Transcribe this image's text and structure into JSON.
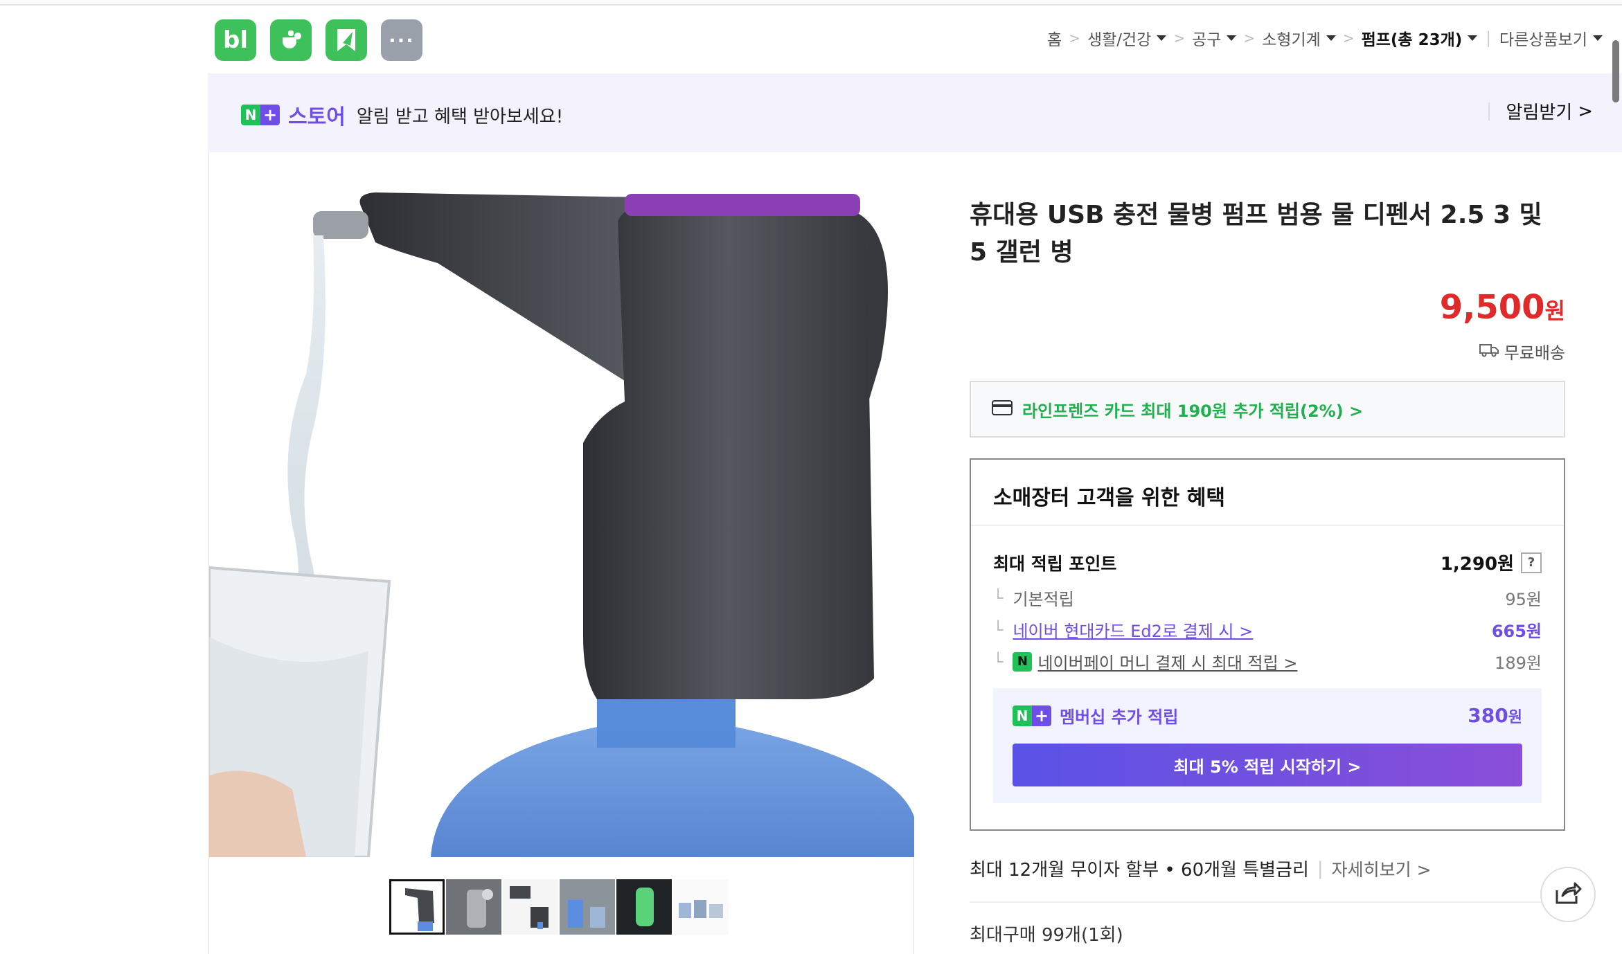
{
  "header": {
    "apps": [
      {
        "name": "blog",
        "label": "bl"
      },
      {
        "name": "cafe",
        "label": ""
      },
      {
        "name": "bookmark",
        "label": ""
      },
      {
        "name": "more",
        "label": "···"
      }
    ],
    "breadcrumb": {
      "home": "홈",
      "c1": "생활/건강",
      "c2": "공구",
      "c3": "소형기계",
      "c4": "펌프(총 23개)",
      "other": "다른상품보기"
    }
  },
  "banner": {
    "badge_n": "N",
    "badge_plus": "+",
    "store": "스토어",
    "message": "알림 받고 혜택 받아보세요!",
    "action": "알림받기",
    "action_chevron": ">"
  },
  "product": {
    "title": "휴대용 USB 충전 물병 펌프 범용 물 디펜서 2.5 3 및 5 갤런 병",
    "price": "9,500",
    "price_unit": "원",
    "shipping": "무료배송",
    "card_promo": "라인프렌즈 카드 최대 190원 추가 적립(2%) >"
  },
  "benefits": {
    "heading": "소매장터 고객을 위한 혜택",
    "max_points_label": "최대 적립 포인트",
    "max_points_value": "1,290원",
    "help": "?",
    "rows": [
      {
        "label": "기본적립",
        "value": "95원"
      },
      {
        "label": "네이버 현대카드 Ed2로 결제 시 >",
        "value": "665원"
      },
      {
        "label": "네이버페이 머니 결제 시 최대 적립 >",
        "value": "189원"
      }
    ],
    "npay_icon": "N",
    "membership_label": "멤버십 추가 적립",
    "membership_value": "380",
    "membership_unit": "원",
    "cta": "최대 5% 적립 시작하기 >"
  },
  "footer": {
    "installment": "최대 12개월 무이자 할부 • 60개월 특별금리",
    "installment_more": "자세히보기 >",
    "max_purchase": "최대구매 99개(1회)"
  },
  "colors": {
    "accent": "#6e4ee6",
    "naver_green": "#21c159",
    "price_red": "#e02a2a"
  },
  "icons": [
    "blog-icon",
    "cafe-icon",
    "bookmark-icon",
    "more-icon",
    "truck-icon",
    "card-icon",
    "share-icon"
  ]
}
